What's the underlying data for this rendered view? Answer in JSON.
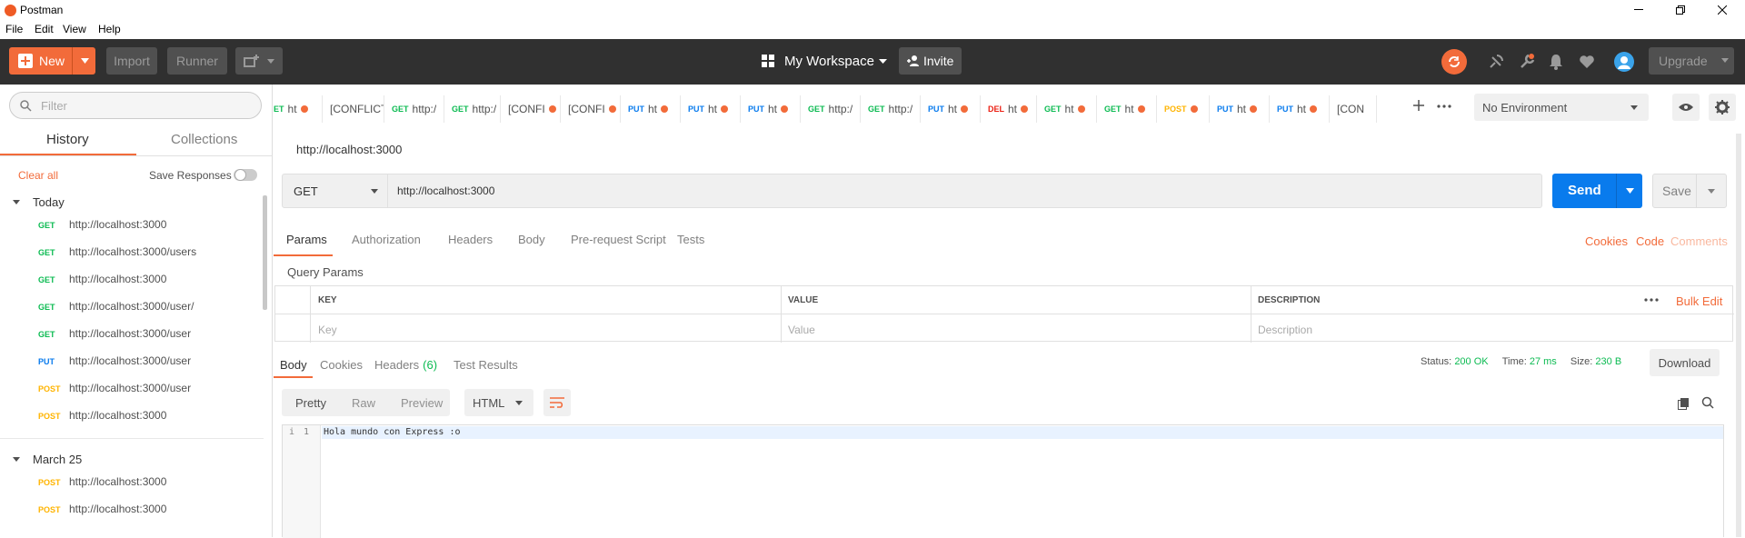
{
  "window": {
    "title": "Postman"
  },
  "menu": [
    "File",
    "Edit",
    "View",
    "Help"
  ],
  "header": {
    "new_label": "New",
    "import_label": "Import",
    "runner_label": "Runner",
    "workspace_label": "My Workspace",
    "invite_label": "Invite",
    "upgrade_label": "Upgrade"
  },
  "sidebar": {
    "filter_placeholder": "Filter",
    "tabs": [
      "History",
      "Collections"
    ],
    "clear_all": "Clear all",
    "save_responses": "Save Responses",
    "groups": [
      {
        "label": "Today",
        "items": [
          {
            "method": "GET",
            "url": "http://localhost:3000"
          },
          {
            "method": "GET",
            "url": "http://localhost:3000/users"
          },
          {
            "method": "GET",
            "url": "http://localhost:3000"
          },
          {
            "method": "GET",
            "url": "http://localhost:3000/user/"
          },
          {
            "method": "GET",
            "url": "http://localhost:3000/user"
          },
          {
            "method": "PUT",
            "url": "http://localhost:3000/user"
          },
          {
            "method": "POST",
            "url": "http://localhost:3000/user"
          },
          {
            "method": "POST",
            "url": "http://localhost:3000"
          }
        ]
      },
      {
        "label": "March 25",
        "items": [
          {
            "method": "POST",
            "url": "http://localhost:3000"
          },
          {
            "method": "POST",
            "url": "http://localhost:3000"
          }
        ]
      }
    ]
  },
  "tabs": [
    {
      "method": "ET",
      "text": "ht",
      "dot": true
    },
    {
      "method": "",
      "text": "[CONFLICT",
      "dot": false
    },
    {
      "method": "GET",
      "text": "http:/",
      "dot": false
    },
    {
      "method": "GET",
      "text": "http:/",
      "dot": false
    },
    {
      "method": "",
      "text": "[CONFI",
      "dot": true
    },
    {
      "method": "",
      "text": "[CONFI",
      "dot": true
    },
    {
      "method": "PUT",
      "text": "ht",
      "dot": true
    },
    {
      "method": "PUT",
      "text": "ht",
      "dot": true
    },
    {
      "method": "PUT",
      "text": "ht",
      "dot": true
    },
    {
      "method": "GET",
      "text": "http:/",
      "dot": false
    },
    {
      "method": "GET",
      "text": "http:/",
      "dot": false
    },
    {
      "method": "PUT",
      "text": "ht",
      "dot": true
    },
    {
      "method": "DEL",
      "text": "ht",
      "dot": true
    },
    {
      "method": "GET",
      "text": "ht",
      "dot": true
    },
    {
      "method": "GET",
      "text": "ht",
      "dot": true
    },
    {
      "method": "POST",
      "text": "",
      "dot": true
    },
    {
      "method": "PUT",
      "text": "ht",
      "dot": true
    },
    {
      "method": "PUT",
      "text": "ht",
      "dot": true
    },
    {
      "method": "",
      "text": "[CON",
      "dot": false
    }
  ],
  "environment": {
    "selected": "No Environment"
  },
  "request": {
    "name": "http://localhost:3000",
    "method": "GET",
    "url": "http://localhost:3000",
    "send_label": "Send",
    "save_label": "Save",
    "tabs": [
      "Params",
      "Authorization",
      "Headers",
      "Body",
      "Pre-request Script",
      "Tests"
    ],
    "right_links": [
      "Cookies",
      "Code",
      "Comments"
    ],
    "query_params_title": "Query Params",
    "columns": [
      "KEY",
      "VALUE",
      "DESCRIPTION"
    ],
    "bulk_edit": "Bulk Edit",
    "placeholders": {
      "key": "Key",
      "value": "Value",
      "description": "Description"
    }
  },
  "response": {
    "tabs": [
      "Body",
      "Cookies",
      "Headers",
      "Test Results"
    ],
    "headers_count": "(6)",
    "status_label": "Status:",
    "status_value": "200 OK",
    "time_label": "Time:",
    "time_value": "27 ms",
    "size_label": "Size:",
    "size_value": "230 B",
    "download_label": "Download",
    "view_modes": [
      "Pretty",
      "Raw",
      "Preview"
    ],
    "format": "HTML",
    "line_number": "1",
    "body_text": "Hola mundo con Express :o"
  },
  "colors": {
    "accent": "#f26b3a",
    "get": "#0cbb52",
    "put": "#097bed",
    "post": "#ffb400",
    "del": "#eb2013",
    "send": "#097bed"
  }
}
